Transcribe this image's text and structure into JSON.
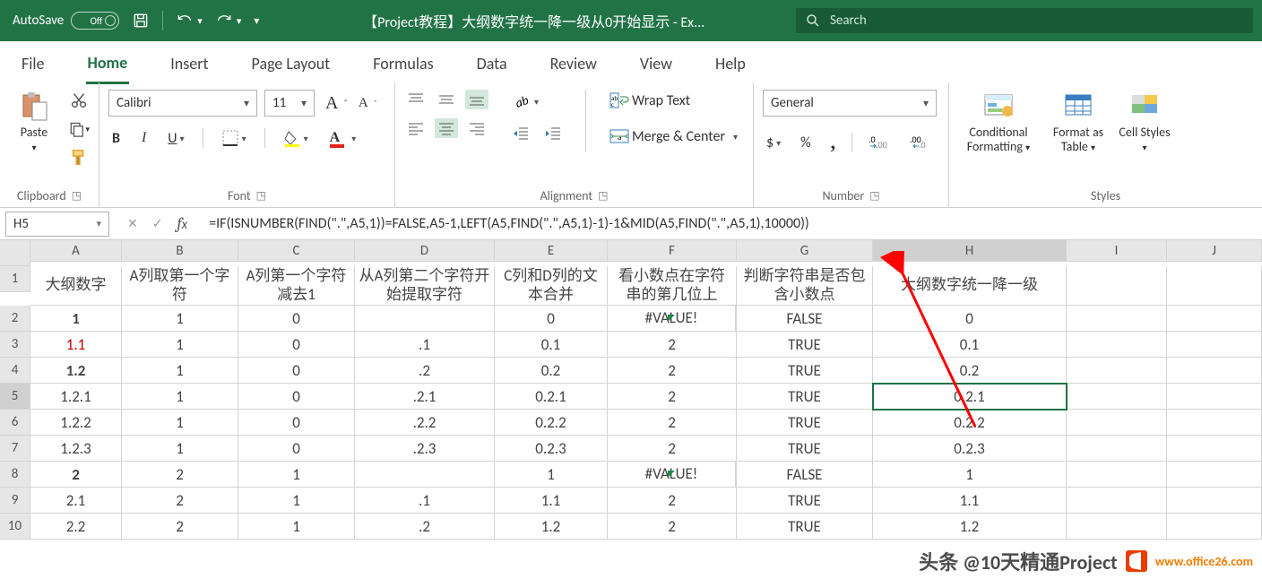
{
  "titlebar": {
    "autosave_label": "AutoSave",
    "autosave_state": "Off",
    "doc_title": "【Project教程】大纲数字统一降一级从0开始显示  -  Ex...",
    "search_placeholder": "Search"
  },
  "tabs": {
    "file": "File",
    "home": "Home",
    "insert": "Insert",
    "pagelayout": "Page Layout",
    "formulas": "Formulas",
    "data": "Data",
    "review": "Review",
    "view": "View",
    "help": "Help"
  },
  "ribbon": {
    "clipboard": {
      "label": "Clipboard",
      "paste": "Paste"
    },
    "font": {
      "label": "Font",
      "name": "Calibri",
      "size": "11",
      "inc": "A",
      "dec": "A",
      "bold": "B",
      "italic": "I",
      "underline": "U"
    },
    "alignment": {
      "label": "Alignment",
      "wrap": "Wrap Text",
      "merge": "Merge & Center"
    },
    "number": {
      "label": "Number",
      "format": "General",
      "currency": "$",
      "percent": "%",
      "comma": ","
    },
    "styles": {
      "label": "Styles",
      "cond": "Conditional Formatting",
      "table": "Format as Table",
      "cell": "Cell Styles"
    }
  },
  "namebox": "H5",
  "formula": "=IF(ISNUMBER(FIND(\".\",A5,1))=FALSE,A5-1,LEFT(A5,FIND(\".\",A5,1)-1)-1&MID(A5,FIND(\".\",A5,1),10000))",
  "cols": [
    "A",
    "B",
    "C",
    "D",
    "E",
    "F",
    "G",
    "H",
    "I",
    "J"
  ],
  "headers": {
    "a": "大纲数字",
    "b": "A列取第一个字符",
    "c": "A列第一个字符减去1",
    "d": "从A列第二个字符开始提取字符",
    "e": "C列和D列的文本合并",
    "f": "看小数点在字符串的第几位上",
    "g": "判断字符串是否包含小数点",
    "h": "大纲数字统一降一级"
  },
  "rows": [
    {
      "n": "2",
      "a": "1",
      "b": "1",
      "c": "0",
      "d": "",
      "e": "0",
      "f": "#VALUE!",
      "g": "FALSE",
      "h": "0"
    },
    {
      "n": "3",
      "a": "1.1",
      "b": "1",
      "c": "0",
      "d": ".1",
      "e": "0.1",
      "f": "2",
      "g": "TRUE",
      "h": "0.1"
    },
    {
      "n": "4",
      "a": "1.2",
      "b": "1",
      "c": "0",
      "d": ".2",
      "e": "0.2",
      "f": "2",
      "g": "TRUE",
      "h": "0.2"
    },
    {
      "n": "5",
      "a": "1.2.1",
      "b": "1",
      "c": "0",
      "d": ".2.1",
      "e": "0.2.1",
      "f": "2",
      "g": "TRUE",
      "h": "0.2.1"
    },
    {
      "n": "6",
      "a": "1.2.2",
      "b": "1",
      "c": "0",
      "d": ".2.2",
      "e": "0.2.2",
      "f": "2",
      "g": "TRUE",
      "h": "0.2.2"
    },
    {
      "n": "7",
      "a": "1.2.3",
      "b": "1",
      "c": "0",
      "d": ".2.3",
      "e": "0.2.3",
      "f": "2",
      "g": "TRUE",
      "h": "0.2.3"
    },
    {
      "n": "8",
      "a": "2",
      "b": "2",
      "c": "1",
      "d": "",
      "e": "1",
      "f": "#VALUE!",
      "g": "FALSE",
      "h": "1"
    },
    {
      "n": "9",
      "a": "2.1",
      "b": "2",
      "c": "1",
      "d": ".1",
      "e": "1.1",
      "f": "2",
      "g": "TRUE",
      "h": "1.1"
    },
    {
      "n": "10",
      "a": "2.2",
      "b": "2",
      "c": "1",
      "d": ".2",
      "e": "1.2",
      "f": "2",
      "g": "TRUE",
      "h": "1.2"
    }
  ],
  "watermark": {
    "text": "头条 @10天精通Project",
    "url": "www.office26.com"
  }
}
